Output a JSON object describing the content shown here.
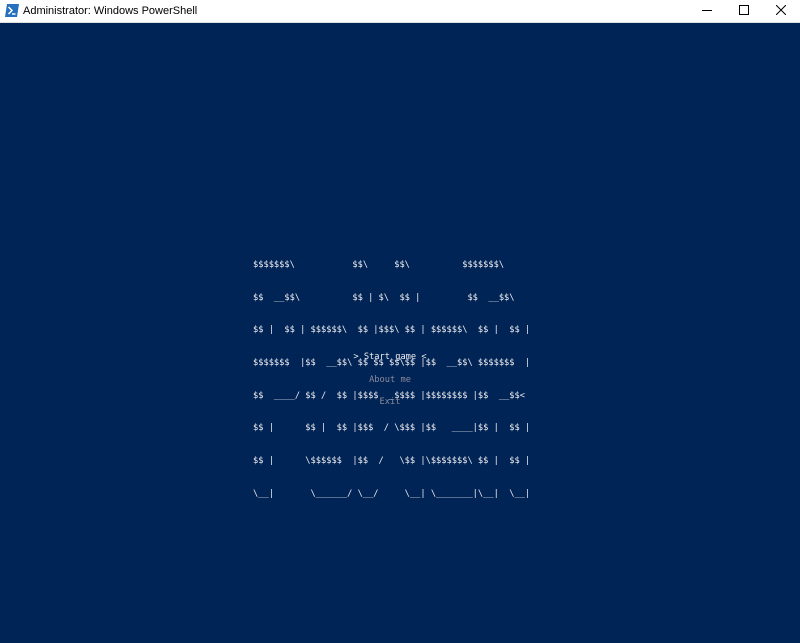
{
  "window": {
    "title": "Administrator: Windows PowerShell",
    "icon": "powershell-icon",
    "controls": {
      "minimize_icon": "minimize-icon",
      "maximize_icon": "maximize-icon",
      "close_icon": "close-icon"
    }
  },
  "colors": {
    "console_background": "#012456",
    "text_primary": "#eeedf0",
    "text_dimmed": "#8a8a99",
    "titlebar_background": "#ffffff"
  },
  "console": {
    "ascii_title_lines": [
      "$$$$$$$\\           $$\\     $$\\          $$$$$$$\\  ",
      "$$  __$$\\          $$ | $\\  $$ |         $$  __$$\\ ",
      "$$ |  $$ | $$$$$$\\  $$ |$$$\\ $$ | $$$$$$\\  $$ |  $$ |",
      "$$$$$$$  |$$  __$$\\ $$ $$ $$\\$$ |$$  __$$\\ $$$$$$$  |",
      "$$  ____/ $$ /  $$ |$$$$  _$$$$ |$$$$$$$$ |$$  __$$< ",
      "$$ |      $$ |  $$ |$$$  / \\$$$ |$$   ____|$$ |  $$ |",
      "$$ |      \\$$$$$$  |$$  /   \\$$ |\\$$$$$$$\\ $$ |  $$ |",
      "\\__|       \\______/ \\__/     \\__| \\_______|\\__|  \\__|"
    ],
    "menu": {
      "start_game": "> Start game <",
      "about_me": "About me",
      "exit": "Exit"
    }
  }
}
